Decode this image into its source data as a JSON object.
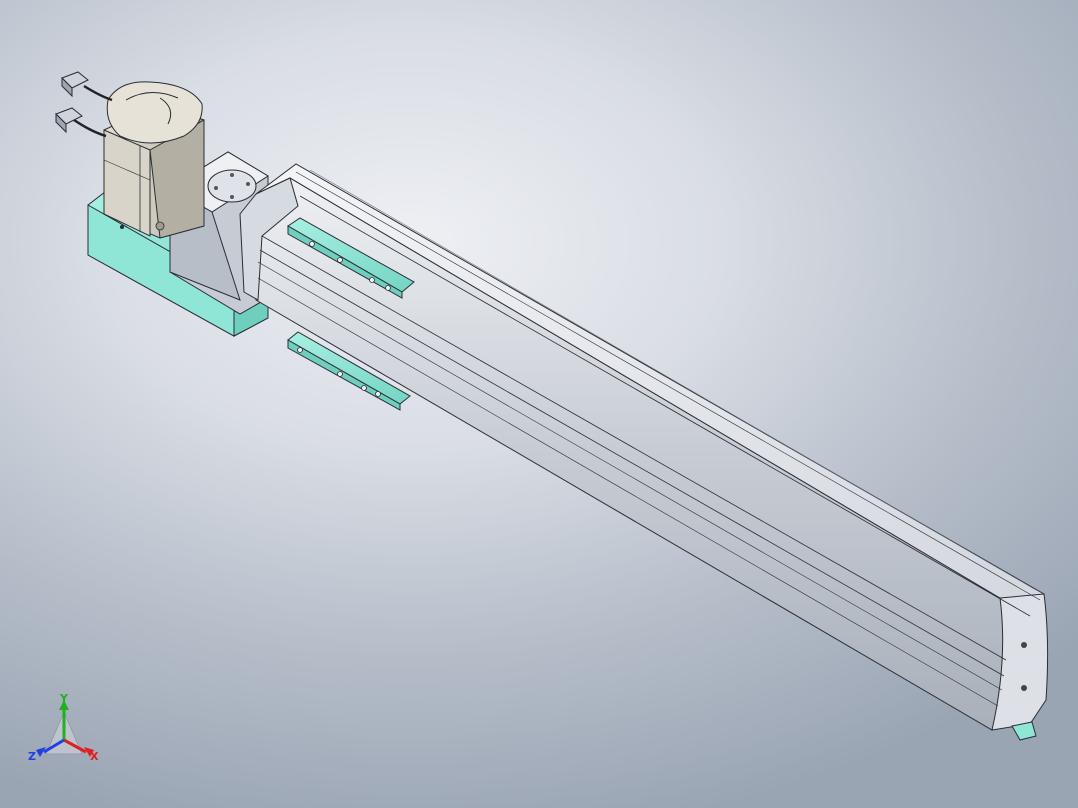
{
  "viewport": {
    "background_top": "#eef0f4",
    "background_bottom": "#9aa5b4"
  },
  "model": {
    "colors": {
      "body": "#c9ced6",
      "body_light": "#e6e9ee",
      "body_dark": "#9ea5b0",
      "edge": "#2a2d33",
      "teal": "#8fe6d6",
      "teal_dark": "#5fbfb0",
      "motor": "#cfcbbf",
      "motor_dark": "#a39f93"
    }
  },
  "triad": {
    "axes": {
      "x": {
        "label": "X",
        "color": "#e02020"
      },
      "y": {
        "label": "Y",
        "color": "#20b020"
      },
      "z": {
        "label": "Z",
        "color": "#2040e0"
      }
    }
  }
}
